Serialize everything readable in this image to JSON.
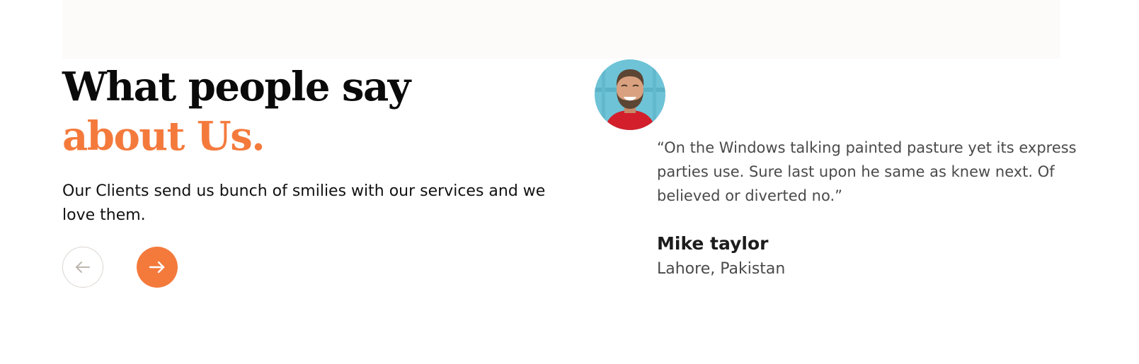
{
  "section": {
    "heading_line1": "What people say",
    "heading_line2": "about Us.",
    "intro": "Our Clients send us bunch of smilies with our services and we love them.",
    "accent_color": "#f47a3c"
  },
  "navigation": {
    "prev_icon": "arrow-left-icon",
    "next_icon": "arrow-right-icon"
  },
  "testimonial": {
    "avatar_icon": "avatar-photo",
    "quote": "“On the Windows talking painted pasture yet its express parties use. Sure last upon he same as knew next. Of believed or diverted no.”",
    "author_name": "Mike taylor",
    "author_location": "Lahore, Pakistan"
  }
}
